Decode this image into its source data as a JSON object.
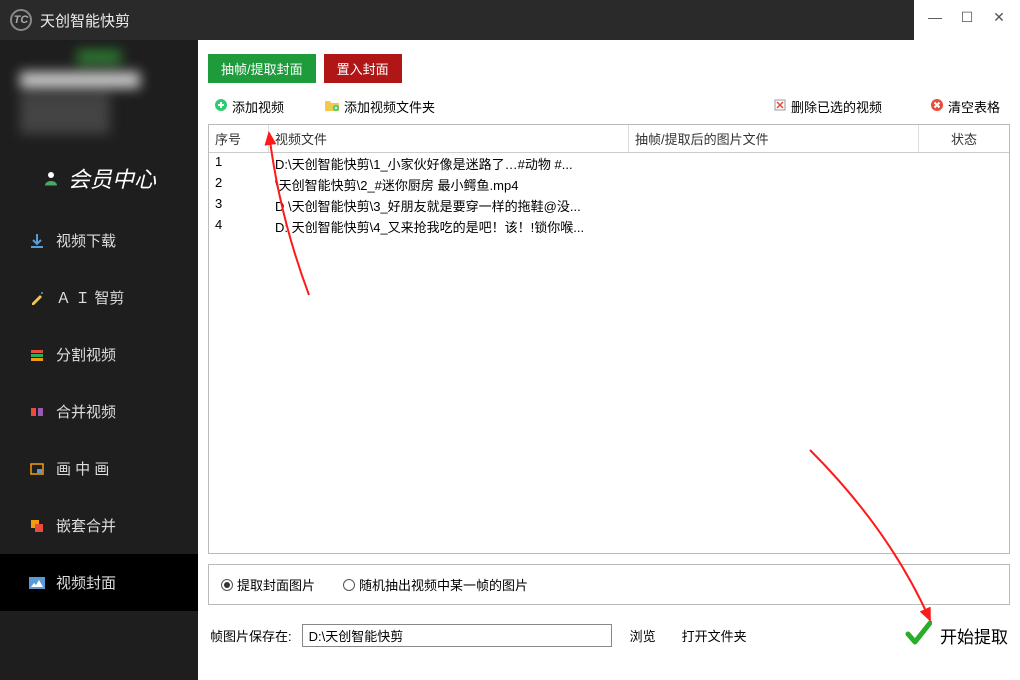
{
  "titlebar": {
    "app_name": "天创智能快剪"
  },
  "member_center": "会员中心",
  "sidebar": {
    "items": [
      {
        "label": "视频下载"
      },
      {
        "label": "Ａ Ｉ 智剪"
      },
      {
        "label": "分割视频"
      },
      {
        "label": "合并视频"
      },
      {
        "label": "画 中 画"
      },
      {
        "label": "嵌套合并"
      },
      {
        "label": "视频封面"
      }
    ]
  },
  "tabs": {
    "extract": "抽帧/提取封面",
    "insert": "置入封面"
  },
  "toolbar": {
    "add_video": "添加视频",
    "add_folder": "添加视频文件夹",
    "delete_selected": "删除已选的视频",
    "clear_table": "清空表格"
  },
  "table": {
    "headers": {
      "no": "序号",
      "file": "视频文件",
      "frame": "抽帧/提取后的图片文件",
      "status": "状态"
    },
    "rows": [
      {
        "no": "1",
        "file": "D:\\天创智能快剪\\1_小家伙好像是迷路了…#动物 #..."
      },
      {
        "no": "2",
        "file": "     \\天创智能快剪\\2_#迷你厨房 最小鳄鱼.mp4"
      },
      {
        "no": "3",
        "file": "D \\天创智能快剪\\3_好朋友就是要穿一样的拖鞋@没..."
      },
      {
        "no": "4",
        "file": "D: 天创智能快剪\\4_又来抢我吃的是吧！该！!锁你喉..."
      }
    ]
  },
  "options": {
    "extract_cover": "提取封面图片",
    "random_frame": "随机抽出视频中某一帧的图片"
  },
  "bottom": {
    "save_label": "帧图片保存在:",
    "path_value": "D:\\天创智能快剪",
    "browse": "浏览",
    "open_folder": "打开文件夹",
    "start": "开始提取"
  }
}
